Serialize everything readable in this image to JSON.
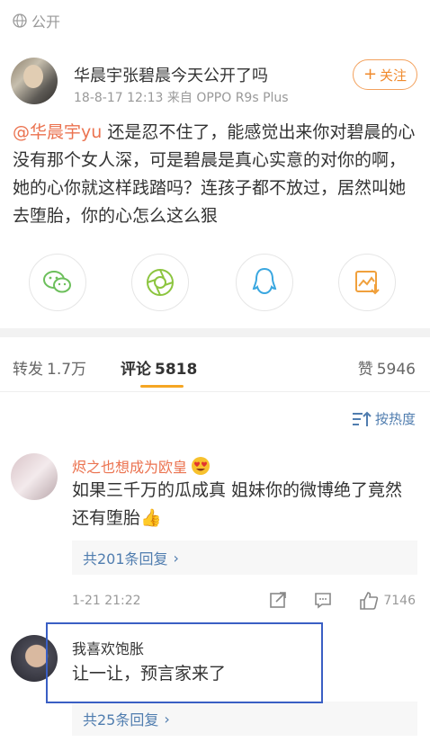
{
  "visibility": {
    "label": "公开",
    "icon": "globe-icon"
  },
  "post": {
    "title": "华晨宇张碧晨今天公开了吗",
    "meta": "18-8-17 12:13  来自 OPPO R9s Plus",
    "follow_label": "关注",
    "mention": "@华晨宇yu",
    "body": " 还是忍不住了，能感觉出来你对碧晨的心没有那个女人深，可是碧晨是真心实意的对你的啊，她的心你就这样践踏吗？连孩子都不放过，居然叫她去堕胎，你的心怎么这么狠"
  },
  "share": [
    "wechat-icon",
    "moments-icon",
    "qq-icon",
    "save-image-icon"
  ],
  "tabs": {
    "repost_label": "转发",
    "repost_count": "1.7万",
    "comment_label": "评论",
    "comment_count": "5818",
    "like_label": "赞",
    "like_count": "5946"
  },
  "sort_label": "按热度",
  "comments": [
    {
      "name": "烬之也想成为欧皇",
      "text": "如果三千万的瓜成真 姐妹你的微博绝了竟然还有堕胎👍",
      "replies": "共201条回复",
      "time": "1-21 21:22",
      "likes": "7146",
      "name_color": "#eb7350"
    },
    {
      "name": "我喜欢饱胀",
      "text": "让一让，预言家来了",
      "replies": "共25条回复"
    }
  ],
  "colors": {
    "accent": "#f08a2c",
    "link": "#507daf",
    "highlight": "#3a5fc4",
    "tab_underline": "#f5a623"
  }
}
